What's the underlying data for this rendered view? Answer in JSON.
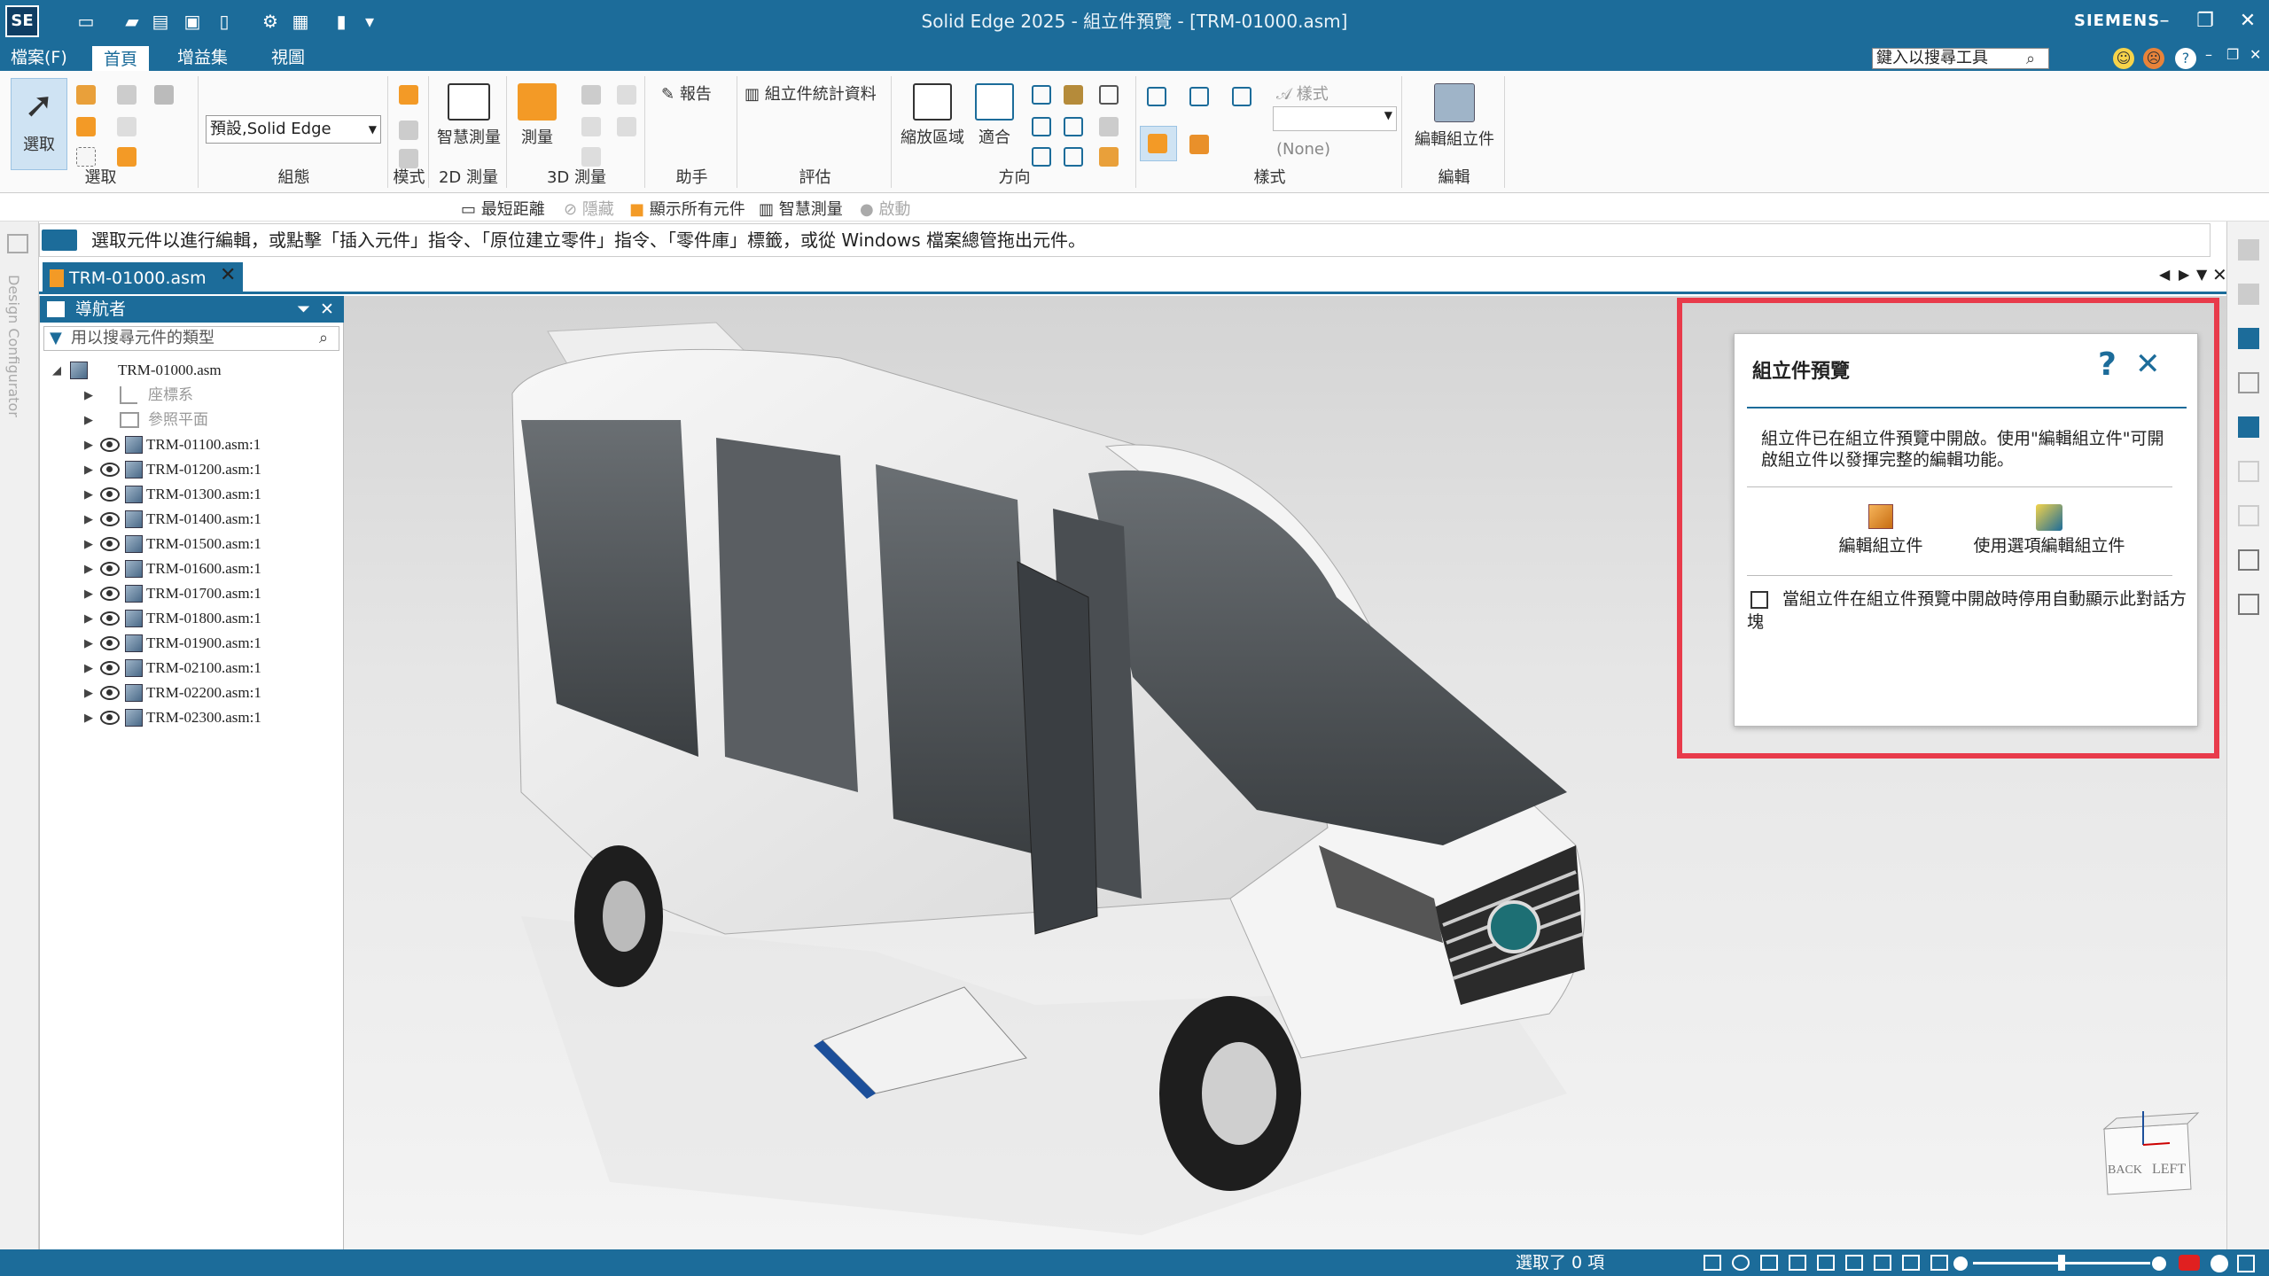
{
  "app": {
    "logo": "SE",
    "title": "Solid Edge 2025 - 組立件預覽 - [TRM-01000.asm]",
    "brand": "SIEMENS",
    "accent": "#1c6c9a"
  },
  "menu": {
    "items": [
      "檔案(F)",
      "首頁",
      "增益集",
      "視圖"
    ],
    "active": "首頁",
    "search_placeholder": "鍵入以搜尋工具"
  },
  "ribbon": {
    "groups": {
      "select": {
        "label": "選取",
        "button": "選取"
      },
      "config": {
        "label": "組態",
        "dropdown": "預設,Solid Edge"
      },
      "mode": {
        "label": "模式"
      },
      "measure2d": {
        "label": "2D 測量",
        "button": "智慧測量"
      },
      "measure3d": {
        "label": "3D 測量",
        "button": "測量"
      },
      "assist": {
        "label": "助手",
        "button": "報告"
      },
      "evaluate": {
        "label": "評估",
        "button": "組立件統計資料"
      },
      "orient": {
        "label": "方向",
        "zoom_area": "縮放區域",
        "fit": "適合"
      },
      "style": {
        "label": "樣式",
        "style_label": "樣式",
        "none_value": "(None)"
      },
      "edit": {
        "label": "編輯",
        "button": "編輯組立件"
      }
    }
  },
  "cmdbar": {
    "items": [
      "最短距離",
      "隱藏",
      "顯示所有元件",
      "智慧測量",
      "啟動"
    ]
  },
  "prompt": "選取元件以進行編輯，或點擊「插入元件」指令、「原位建立零件」指令、「零件庫」標籤，或從 Windows 檔案總管拖出元件。",
  "doc_tab": "TRM-01000.asm",
  "left_strip_label": "Design Configurator",
  "navigator": {
    "title": "導航者",
    "filter_placeholder": "用以搜尋元件的類型",
    "root": "TRM-01000.asm",
    "special": [
      "座標系",
      "參照平面"
    ],
    "items": [
      "TRM-01100.asm:1",
      "TRM-01200.asm:1",
      "TRM-01300.asm:1",
      "TRM-01400.asm:1",
      "TRM-01500.asm:1",
      "TRM-01600.asm:1",
      "TRM-01700.asm:1",
      "TRM-01800.asm:1",
      "TRM-01900.asm:1",
      "TRM-02100.asm:1",
      "TRM-02200.asm:1",
      "TRM-02300.asm:1"
    ]
  },
  "dialog": {
    "title": "組立件預覽",
    "message": "組立件已在組立件預覽中開啟。使用\"編輯組立件\"可開啟組立件以發揮完整的編輯功能。",
    "btn_edit": "編輯組立件",
    "btn_edit_options": "使用選項編輯組立件",
    "checkbox": "當組立件在組立件預覽中開啟時停用自動顯示此對話方塊",
    "highlight_color": "#e83b4b"
  },
  "viewcube": {
    "back": "BACK",
    "left": "LEFT"
  },
  "status": {
    "selected": "選取了 0 項"
  }
}
